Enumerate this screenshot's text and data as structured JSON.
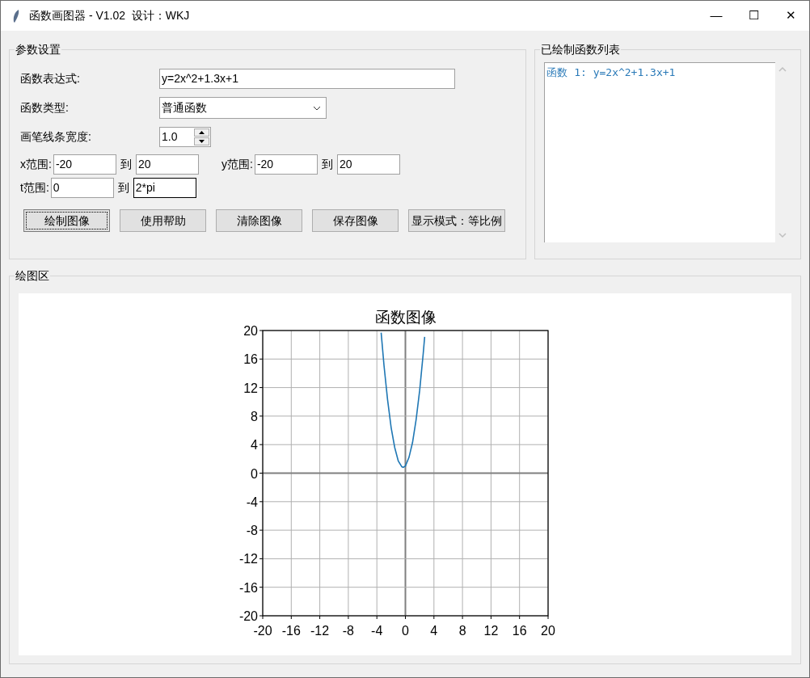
{
  "window": {
    "title": "函数画图器 - V1.02  设计：WKJ",
    "controls": [
      "—",
      "☐",
      "✕"
    ]
  },
  "params": {
    "title": "参数设置",
    "expression": {
      "label": "函数表达式:",
      "value": "y=2x^2+1.3x+1"
    },
    "type": {
      "label": "函数类型:",
      "value": "普通函数"
    },
    "line_width": {
      "label": "画笔线条宽度:",
      "value": "1.0"
    },
    "ranges": [
      {
        "label": "x范围:",
        "from": "-20",
        "sep": "到",
        "to": "20",
        "focused": false
      },
      {
        "label": "y范围:",
        "from": "-20",
        "sep": "到",
        "to": "20",
        "focused": false
      },
      {
        "label": "t范围:",
        "from": "0",
        "sep": "到",
        "to": "2*pi",
        "focused": true
      }
    ],
    "buttons": [
      {
        "label": "绘制图像",
        "focused": true
      },
      {
        "label": "使用帮助",
        "focused": false
      },
      {
        "label": "清除图像",
        "focused": false
      },
      {
        "label": "保存图像",
        "focused": false
      },
      {
        "label": "显示模式：等比例",
        "focused": false
      }
    ]
  },
  "list_panel": {
    "title": "已绘制函数列表",
    "items": [
      {
        "text": "函数 1: y=2x^2+1.3x+1"
      }
    ]
  },
  "plot": {
    "title": "绘图区",
    "chart_data": {
      "type": "line",
      "title": "函数图像",
      "xlim": [
        -20,
        20
      ],
      "ylim": [
        -20,
        20
      ],
      "xticks": [
        -20,
        -16,
        -12,
        -8,
        -4,
        0,
        4,
        8,
        12,
        16,
        20
      ],
      "yticks": [
        -20,
        -16,
        -12,
        -8,
        -4,
        0,
        4,
        8,
        12,
        16,
        20
      ],
      "grid": true,
      "x": [
        -3.4,
        -3,
        -2.5,
        -2,
        -1.5,
        -1,
        -0.5,
        -0.3,
        0,
        0.5,
        1,
        1.5,
        2,
        2.5,
        2.7
      ],
      "series": [
        {
          "color": "#1f77b4",
          "values": [
            19.7,
            15.1,
            10.3,
            6.4,
            3.6,
            1.7,
            0.9,
            0.8,
            1,
            2.2,
            4.3,
            7.5,
            11.6,
            16.8,
            19.1
          ]
        }
      ]
    }
  }
}
